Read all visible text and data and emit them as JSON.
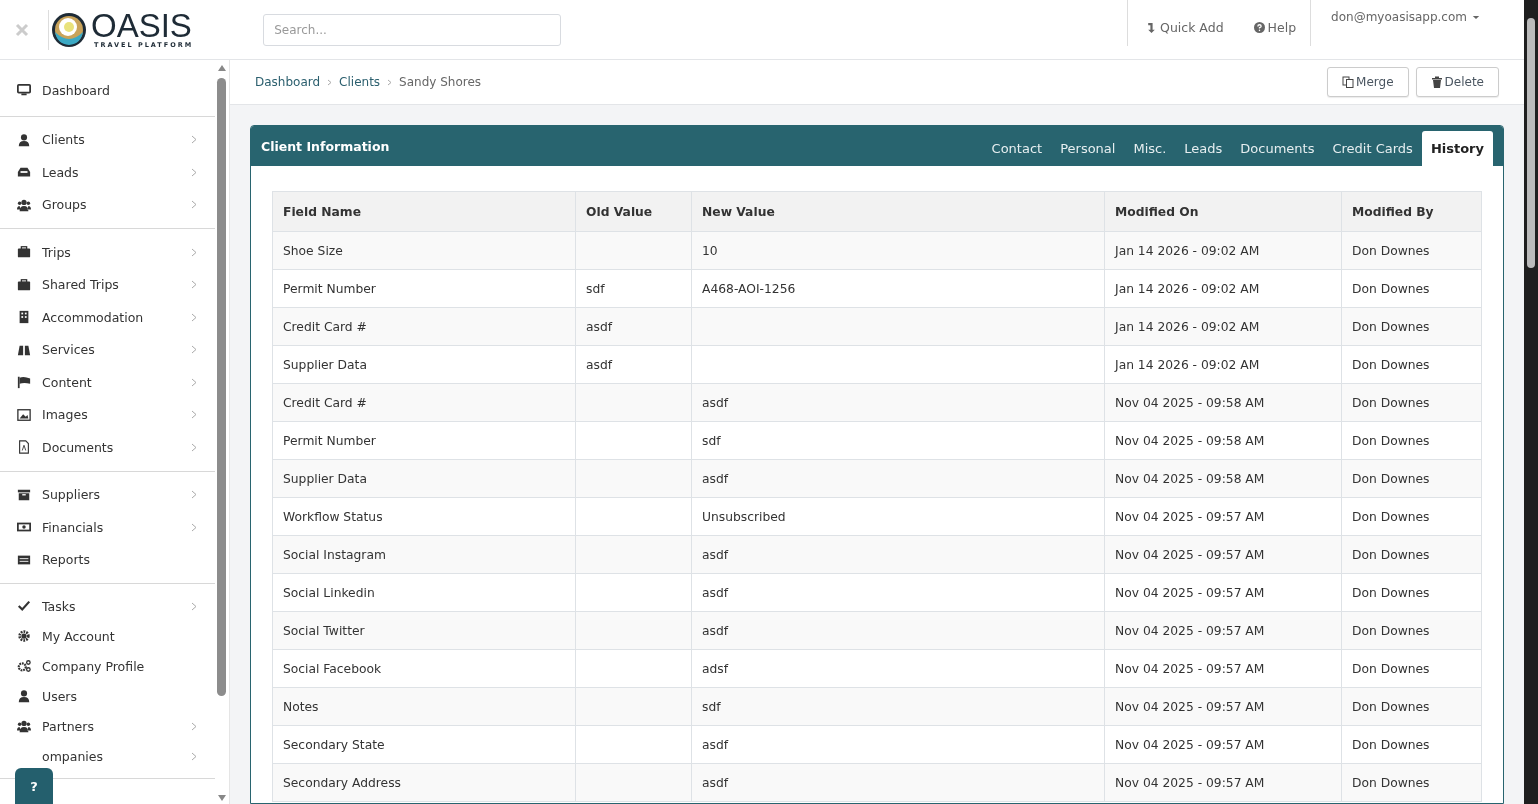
{
  "header": {
    "logo": {
      "name": "OASIS",
      "tagline": "TRAVEL PLATFORM"
    },
    "search": {
      "placeholder": "Search..."
    },
    "quick_add": "Quick Add",
    "help": "Help",
    "user": "don@myoasisapp.com"
  },
  "sidebar": {
    "sections": [
      {
        "items": [
          {
            "kind": "monitor",
            "label": "Dashboard",
            "expandable": false
          }
        ]
      },
      {
        "items": [
          {
            "kind": "user",
            "label": "Clients",
            "expandable": true
          },
          {
            "kind": "inbox",
            "label": "Leads",
            "expandable": true
          },
          {
            "kind": "users",
            "label": "Groups",
            "expandable": true
          }
        ]
      },
      {
        "items": [
          {
            "kind": "suitcase",
            "label": "Trips",
            "expandable": true
          },
          {
            "kind": "suitcase",
            "label": "Shared Trips",
            "expandable": true
          },
          {
            "kind": "building",
            "label": "Accommodation",
            "expandable": true
          },
          {
            "kind": "binoculars",
            "label": "Services",
            "expandable": true
          },
          {
            "kind": "flag",
            "label": "Content",
            "expandable": true
          },
          {
            "kind": "image",
            "label": "Images",
            "expandable": true
          },
          {
            "kind": "file",
            "label": "Documents",
            "expandable": true
          }
        ]
      },
      {
        "items": [
          {
            "kind": "archive",
            "label": "Suppliers",
            "expandable": true
          },
          {
            "kind": "money",
            "label": "Financials",
            "expandable": true
          },
          {
            "kind": "list",
            "label": "Reports",
            "expandable": false
          }
        ]
      },
      {
        "items": [
          {
            "kind": "check",
            "label": "Tasks",
            "expandable": true
          },
          {
            "kind": "gear",
            "label": "My Account",
            "expandable": false
          },
          {
            "kind": "gears",
            "label": "Company Profile",
            "expandable": false
          },
          {
            "kind": "user",
            "label": "Users",
            "expandable": false
          },
          {
            "kind": "users",
            "label": "Partners",
            "expandable": true
          },
          {
            "kind": "hidden",
            "label": "ompanies",
            "expandable": true
          }
        ]
      }
    ],
    "help_button": "?"
  },
  "breadcrumb": [
    "Dashboard",
    "Clients",
    "Sandy Shores"
  ],
  "actions": [
    {
      "kind": "merge",
      "label": "Merge"
    },
    {
      "kind": "delete",
      "label": "Delete"
    }
  ],
  "card": {
    "title": "Client Information",
    "tabs": [
      {
        "label": "Contact",
        "selected": false
      },
      {
        "label": "Personal",
        "selected": false
      },
      {
        "label": "Misc.",
        "selected": false
      },
      {
        "label": "Leads",
        "selected": false
      },
      {
        "label": "Documents",
        "selected": false
      },
      {
        "label": "Credit Cards",
        "selected": false
      },
      {
        "label": "History",
        "selected": true
      }
    ]
  },
  "table": {
    "columns": [
      "Field Name",
      "Old Value",
      "New Value",
      "Modified On",
      "Modified By"
    ],
    "rows": [
      [
        "Shoe Size",
        "",
        "10",
        "Jan 14 2026 - 09:02 AM",
        "Don Downes"
      ],
      [
        "Permit Number",
        "sdf",
        "A468-AOI-1256",
        "Jan 14 2026 - 09:02 AM",
        "Don Downes"
      ],
      [
        "Credit Card #",
        "asdf",
        "",
        "Jan 14 2026 - 09:02 AM",
        "Don Downes"
      ],
      [
        "Supplier Data",
        "asdf",
        "",
        "Jan 14 2026 - 09:02 AM",
        "Don Downes"
      ],
      [
        "Credit Card #",
        "",
        "asdf",
        "Nov 04 2025 - 09:58 AM",
        "Don Downes"
      ],
      [
        "Permit Number",
        "",
        "sdf",
        "Nov 04 2025 - 09:58 AM",
        "Don Downes"
      ],
      [
        "Supplier Data",
        "",
        "asdf",
        "Nov 04 2025 - 09:58 AM",
        "Don Downes"
      ],
      [
        "Workflow Status",
        "",
        "Unsubscribed",
        "Nov 04 2025 - 09:57 AM",
        "Don Downes"
      ],
      [
        "Social Instagram",
        "",
        "asdf",
        "Nov 04 2025 - 09:57 AM",
        "Don Downes"
      ],
      [
        "Social Linkedin",
        "",
        "asdf",
        "Nov 04 2025 - 09:57 AM",
        "Don Downes"
      ],
      [
        "Social Twitter",
        "",
        "asdf",
        "Nov 04 2025 - 09:57 AM",
        "Don Downes"
      ],
      [
        "Social Facebook",
        "",
        "adsf",
        "Nov 04 2025 - 09:57 AM",
        "Don Downes"
      ],
      [
        "Notes",
        "",
        "sdf",
        "Nov 04 2025 - 09:57 AM",
        "Don Downes"
      ],
      [
        "Secondary State",
        "",
        "asdf",
        "Nov 04 2025 - 09:57 AM",
        "Don Downes"
      ],
      [
        "Secondary Address",
        "",
        "asdf",
        "Nov 04 2025 - 09:57 AM",
        "Don Downes"
      ]
    ]
  }
}
